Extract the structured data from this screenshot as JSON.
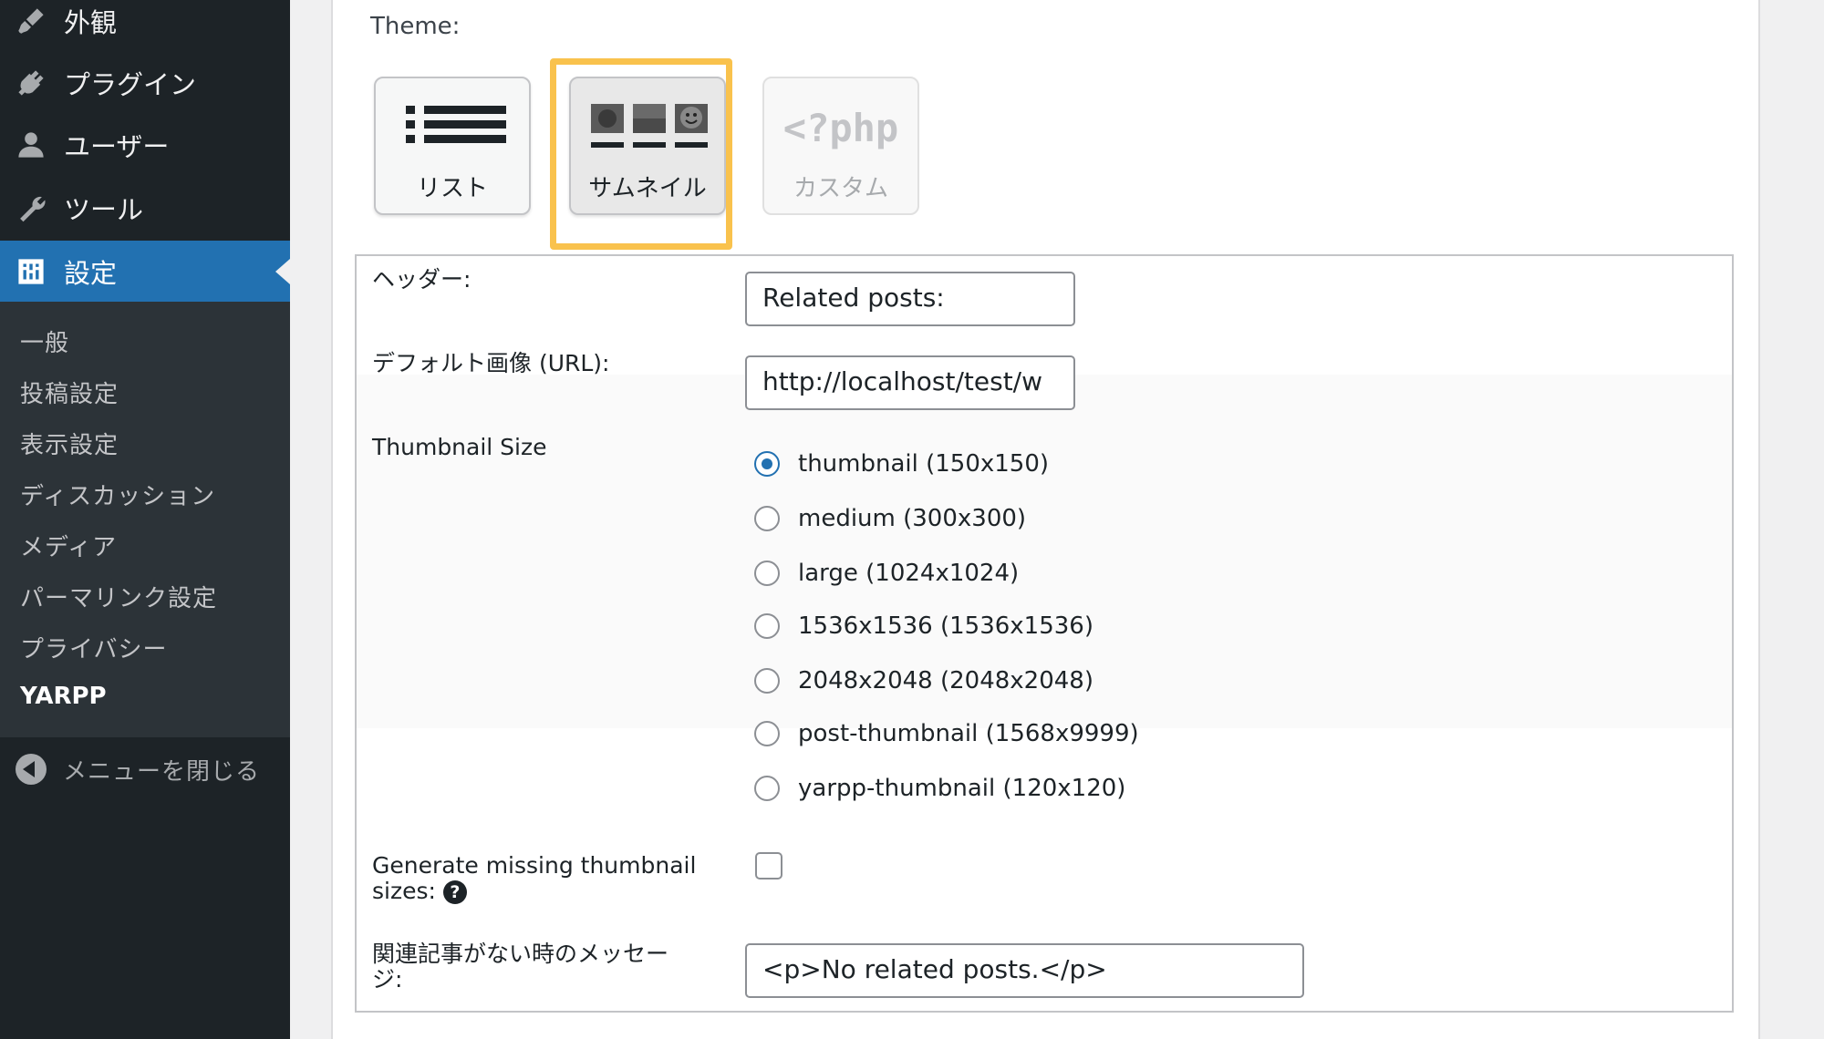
{
  "sidebar": {
    "items": [
      {
        "label": "外観",
        "icon": "paintbrush-icon"
      },
      {
        "label": "プラグイン",
        "icon": "plugin-icon"
      },
      {
        "label": "ユーザー",
        "icon": "user-icon"
      },
      {
        "label": "ツール",
        "icon": "wrench-icon"
      },
      {
        "label": "設定",
        "icon": "settings-icon",
        "current": true
      }
    ],
    "submenu": [
      "一般",
      "投稿設定",
      "表示設定",
      "ディスカッション",
      "メディア",
      "パーマリンク設定",
      "プライバシー",
      "YARPP"
    ],
    "submenu_current": "YARPP",
    "collapse_label": "メニューを閉じる"
  },
  "theme": {
    "label": "Theme:",
    "options": [
      {
        "label": "リスト",
        "icon": "list-icon"
      },
      {
        "label": "サムネイル",
        "icon": "thumbnails-icon",
        "selected": true
      },
      {
        "label": "カスタム",
        "icon": "php-icon",
        "icon_text": "<?php",
        "disabled": true
      }
    ]
  },
  "form": {
    "header_label": "ヘッダー:",
    "header_value": "Related posts:",
    "default_image_label": "デフォルト画像 (URL):",
    "default_image_value": "http://localhost/test/w",
    "thumbnail_size_label": "Thumbnail Size",
    "thumbnail_sizes": [
      {
        "label": "thumbnail (150x150)",
        "checked": true
      },
      {
        "label": "medium (300x300)",
        "checked": false
      },
      {
        "label": "large (1024x1024)",
        "checked": false
      },
      {
        "label": "1536x1536 (1536x1536)",
        "checked": false
      },
      {
        "label": "2048x2048 (2048x2048)",
        "checked": false
      },
      {
        "label": "post-thumbnail (1568x9999)",
        "checked": false
      },
      {
        "label": "yarpp-thumbnail (120x120)",
        "checked": false
      }
    ],
    "generate_missing_label_line1": "Generate missing thumbnail",
    "generate_missing_label_line2": "sizes:",
    "generate_missing_checked": false,
    "help_icon_text": "?",
    "no_related_label_line1": "関連記事がない時のメッセー",
    "no_related_label_line2": "ジ:",
    "no_related_value": "<p>No related posts.</p>"
  },
  "colors": {
    "sidebar_bg": "#1d2327",
    "accent": "#2271b1",
    "highlight": "#f9c24d"
  }
}
